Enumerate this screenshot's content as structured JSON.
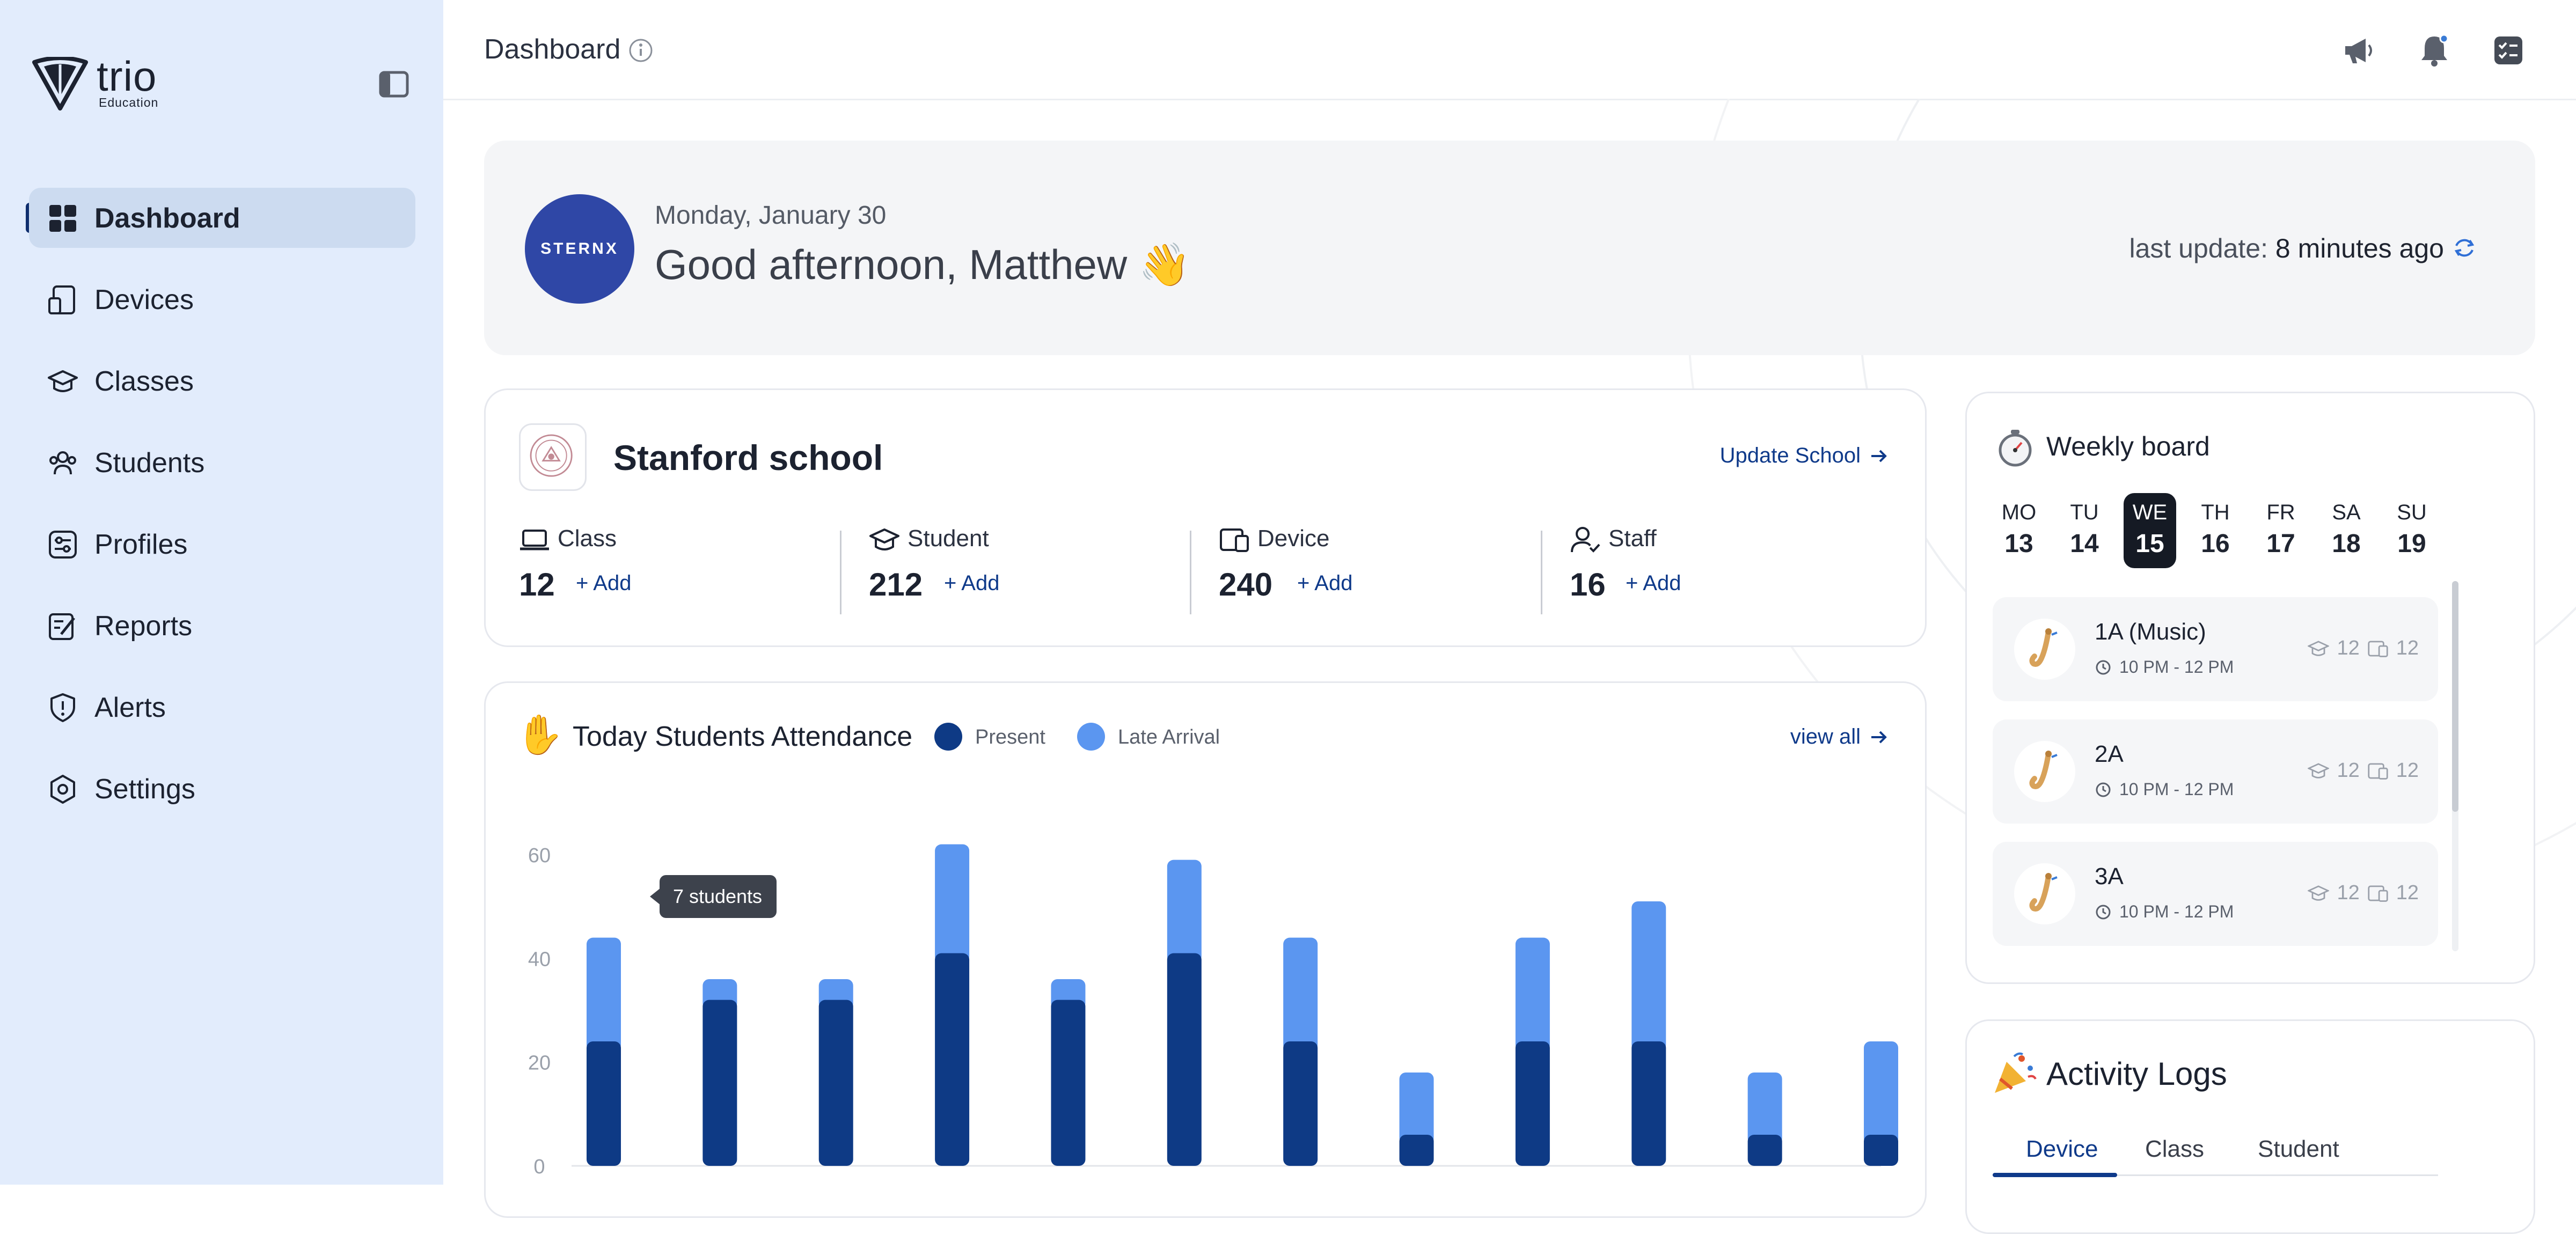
{
  "app": {
    "name": "trio",
    "subtitle": "Education"
  },
  "sidebar": {
    "items": [
      {
        "label": "Dashboard",
        "icon": "dashboard-grid-icon",
        "active": true
      },
      {
        "label": "Devices",
        "icon": "devices-icon"
      },
      {
        "label": "Classes",
        "icon": "graduation-cap-icon"
      },
      {
        "label": "Students",
        "icon": "students-icon"
      },
      {
        "label": "Profiles",
        "icon": "profiles-sliders-icon"
      },
      {
        "label": "Reports",
        "icon": "reports-icon"
      },
      {
        "label": "Alerts",
        "icon": "shield-alert-icon"
      },
      {
        "label": "Settings",
        "icon": "settings-gear-icon"
      }
    ]
  },
  "header": {
    "title": "Dashboard"
  },
  "greeting": {
    "org_logo_text": "STERNX",
    "date": "Monday, January 30",
    "message": "Good afternoon, Matthew 👋",
    "last_update_label": "last update:",
    "last_update_value": "8 minutes ago"
  },
  "school": {
    "name": "Stanford school",
    "update_label": "Update School",
    "stats": [
      {
        "label": "Class",
        "value": "12",
        "add": "Add",
        "icon": "laptop-icon"
      },
      {
        "label": "Student",
        "value": "212",
        "add": "Add",
        "icon": "graduation-cap-icon"
      },
      {
        "label": "Device",
        "value": "240",
        "add": "Add",
        "icon": "device-icon"
      },
      {
        "label": "Staff",
        "value": "16",
        "add": "Add",
        "icon": "staff-icon"
      }
    ]
  },
  "attendance": {
    "title": "Today Students Attendance",
    "emoji": "✋",
    "legend_present": "Present",
    "legend_late": "Late Arrival",
    "view_all": "view all",
    "tooltip": "7 students",
    "colors": {
      "present": "#0e3a85",
      "late": "#5b96f0"
    }
  },
  "chart_data": {
    "type": "bar",
    "stacked": true,
    "categories": [
      "",
      "",
      "",
      "",
      "",
      "",
      "",
      "",
      "",
      "",
      "",
      ""
    ],
    "series": [
      {
        "name": "Present",
        "values": [
          24,
          32,
          32,
          41,
          32,
          41,
          24,
          6,
          24,
          24,
          6,
          6
        ]
      },
      {
        "name": "Late Arrival",
        "values": [
          20,
          4,
          4,
          21,
          4,
          18,
          20,
          12,
          20,
          27,
          12,
          18
        ]
      }
    ],
    "yticks": [
      0,
      20,
      40,
      60
    ],
    "ylim": [
      0,
      65
    ],
    "grid": false
  },
  "weekly": {
    "title": "Weekly board",
    "days": [
      {
        "name": "MO",
        "date": "13"
      },
      {
        "name": "TU",
        "date": "14"
      },
      {
        "name": "WE",
        "date": "15",
        "selected": true
      },
      {
        "name": "TH",
        "date": "16"
      },
      {
        "name": "FR",
        "date": "17"
      },
      {
        "name": "SA",
        "date": "18"
      },
      {
        "name": "SU",
        "date": "19"
      }
    ],
    "classes": [
      {
        "name": "1A (Music)",
        "time": "10 PM - 12 PM",
        "students": "12",
        "devices": "12",
        "icon": "saxophone-icon"
      },
      {
        "name": "2A",
        "time": "10 PM - 12 PM",
        "students": "12",
        "devices": "12",
        "icon": "saxophone-icon"
      },
      {
        "name": "3A",
        "time": "10 PM - 12 PM",
        "students": "12",
        "devices": "12",
        "icon": "saxophone-icon"
      }
    ]
  },
  "activity": {
    "title": "Activity Logs",
    "tabs": [
      "Device",
      "Class",
      "Student"
    ]
  }
}
